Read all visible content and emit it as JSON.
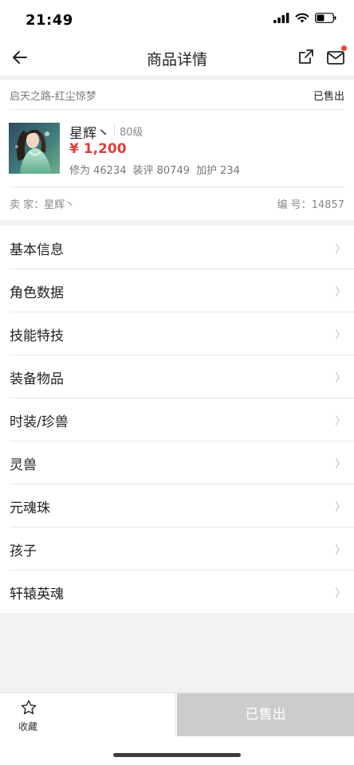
{
  "status_bar": {
    "time": "21:49"
  },
  "nav": {
    "title": "商品详情"
  },
  "product": {
    "game_server": "启天之路-红尘惊梦",
    "status": "已售出",
    "name": "星辉丶",
    "level": "80级",
    "price": "¥ 1,200",
    "stats": [
      "修为 46234",
      "装评 80749",
      "加护 234"
    ],
    "seller": "卖 家：星辉丶",
    "listing_id": "编 号：14857"
  },
  "menu": [
    {
      "label": "基本信息"
    },
    {
      "label": "角色数据"
    },
    {
      "label": "技能特技"
    },
    {
      "label": "装备物品"
    },
    {
      "label": "时装/珍兽"
    },
    {
      "label": "灵兽"
    },
    {
      "label": "元魂珠"
    },
    {
      "label": "孩子"
    },
    {
      "label": "轩辕英魂"
    }
  ],
  "bottom": {
    "favorite_label": "收藏",
    "sold_button_label": "已售出"
  },
  "colors": {
    "price": "#e23c3c",
    "sold_button_bg": "#cccccc",
    "notification_dot": "#f0453a"
  },
  "icons": [
    "back-arrow-icon",
    "share-icon",
    "mail-icon",
    "chevron-right-icon",
    "star-icon"
  ]
}
